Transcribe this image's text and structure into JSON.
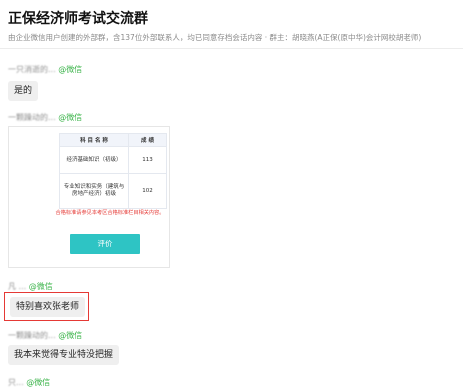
{
  "header": {
    "title": "正保经济师考试交流群",
    "subtitle": "由企业微信用户创建的外部群，含137位外部联系人，均已同意存档会话内容 · 群主：胡晓燕(A正保(原中华)会计网校胡老师)"
  },
  "messages": [
    {
      "sender": "一只消逝的...",
      "source": "@微信",
      "text": "是的"
    },
    {
      "sender": "一颗躁动的...",
      "source": "@微信",
      "image": {
        "table": {
          "headers": [
            "科 目 名 称",
            "成 绩"
          ],
          "rows": [
            {
              "subject": "经济基础知识（初级）",
              "score": "113"
            },
            {
              "subject": "专业知识和实务（建筑与房地产经济）初级",
              "score": "102"
            }
          ]
        },
        "note": "合格标准请参见本考区合格标准栏目相关内容。",
        "button": "评价"
      }
    },
    {
      "sender": "凡 ...",
      "source": "@微信",
      "text": "特别喜欢张老师",
      "highlighted": true
    },
    {
      "sender": "一颗躁动的...",
      "source": "@微信",
      "text": "我本来觉得专业特没把握"
    },
    {
      "sender": "只...",
      "source": "@微信",
      "text": ""
    }
  ],
  "colors": {
    "source_green": "#3cb44b",
    "highlight_red": "#e53935",
    "button_teal": "#2ec4c4",
    "bubble_gray": "#efefef"
  }
}
